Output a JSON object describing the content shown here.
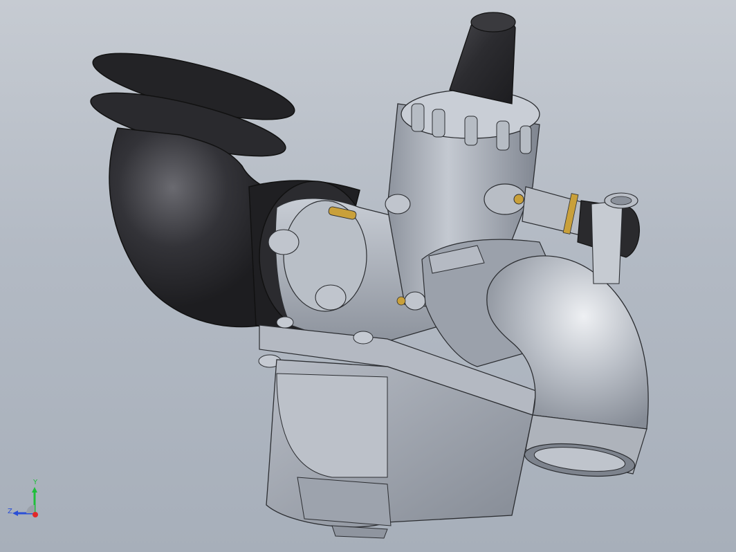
{
  "viewport": {
    "model": "carburetor-assembly",
    "background_top": "#c6cbd2",
    "background_bottom": "#a7afba"
  },
  "triad": {
    "y_label": "Y",
    "z_label": "Z",
    "y_color": "#1fbf3a",
    "z_color": "#2a4fd6",
    "x_color": "#e12828"
  },
  "colors": {
    "rubber": "#2d2d30",
    "body_metal": "#a6acb6",
    "body_light": "#c7ccd4",
    "brass": "#c9a03a"
  }
}
